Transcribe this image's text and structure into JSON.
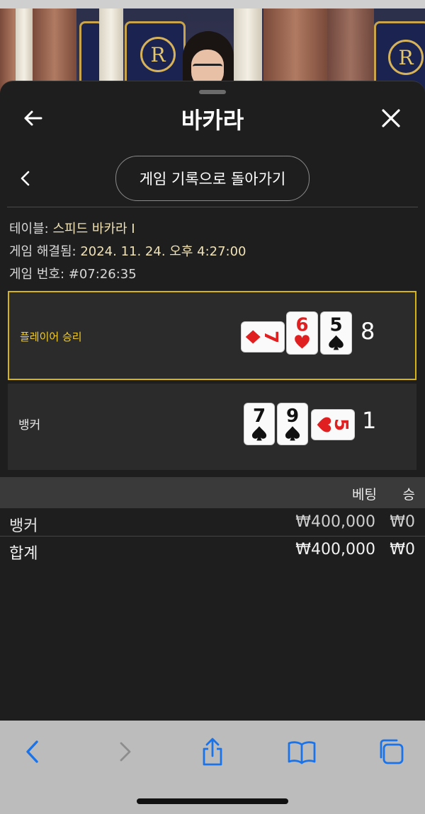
{
  "header": {
    "title": "바카라"
  },
  "back_to_history_label": "게임 기록으로 돌아가기",
  "info": {
    "table_label": "테이블:",
    "table_value": "스피드 바카라 I",
    "resolved_label": "게임 해결됨:",
    "resolved_value": "2024. 11. 24. 오후 4:27:00",
    "game_no_label": "게임 번호:",
    "game_no_value": "#07:26:35"
  },
  "player": {
    "label": "플레이어 승리",
    "score": "8",
    "cards": [
      {
        "rank": "7",
        "suit": "diamond",
        "color": "#e02020",
        "rotated": true
      },
      {
        "rank": "6",
        "suit": "heart",
        "color": "#e02020",
        "rotated": false
      },
      {
        "rank": "5",
        "suit": "spade",
        "color": "#111111",
        "rotated": false
      }
    ]
  },
  "banker": {
    "label": "뱅커",
    "score": "1",
    "cards": [
      {
        "rank": "7",
        "suit": "spade",
        "color": "#111111",
        "rotated": false
      },
      {
        "rank": "9",
        "suit": "spade",
        "color": "#111111",
        "rotated": false
      },
      {
        "rank": "5",
        "suit": "heart",
        "color": "#e02020",
        "rotated": true
      }
    ]
  },
  "bets": {
    "columns": [
      "베팅",
      "승"
    ],
    "rows": [
      {
        "name": "뱅커",
        "bet": "₩400,000",
        "win": "₩0"
      }
    ],
    "total": {
      "name": "합계",
      "bet": "₩400,000",
      "win": "₩0"
    }
  },
  "colors": {
    "win_border": "#d6b414",
    "win_text": "#f2cc2a",
    "ios_blue": "#1a73e8"
  },
  "toolbar_icons": [
    "back-icon",
    "forward-icon",
    "share-icon",
    "bookmarks-icon",
    "tabs-icon"
  ]
}
